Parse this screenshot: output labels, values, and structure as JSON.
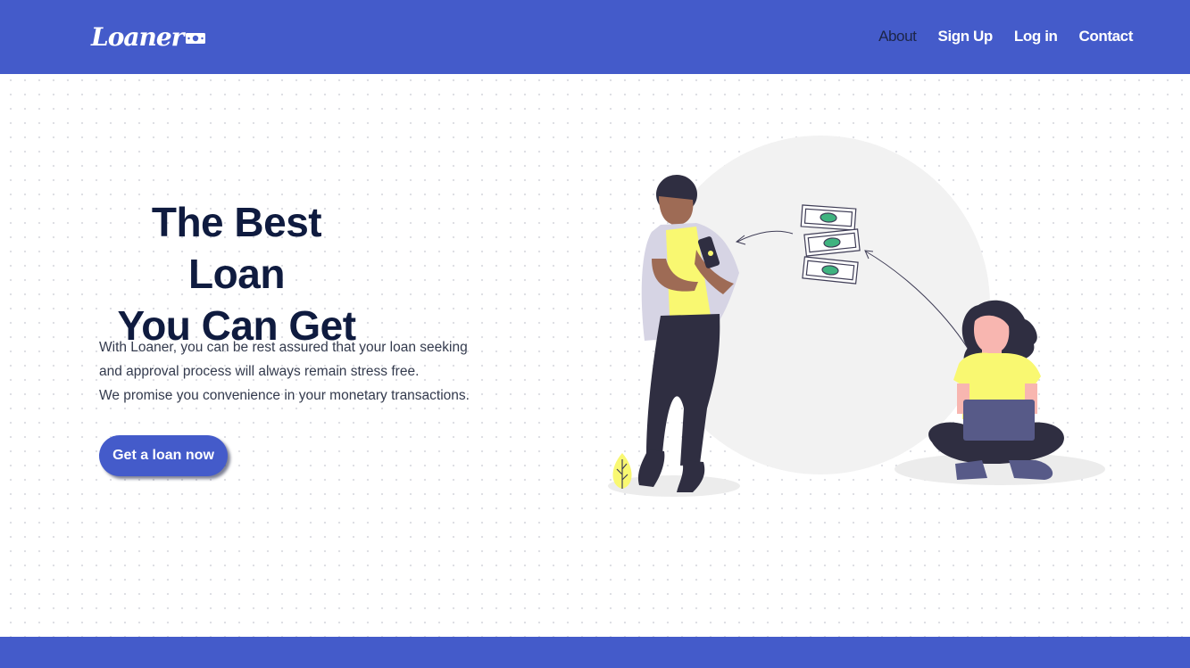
{
  "brand": {
    "name": "Loaner",
    "bill_icon": "money-bill-icon"
  },
  "nav": {
    "items": [
      {
        "label": "About",
        "active": true
      },
      {
        "label": "Sign Up",
        "active": false
      },
      {
        "label": "Log in",
        "active": false
      },
      {
        "label": "Contact",
        "active": false
      }
    ]
  },
  "hero": {
    "title_lines": [
      "The Best Loan",
      "You Can Get"
    ],
    "description_lines": [
      "With Loaner, you can be rest assured that your loan seeking",
      "and approval process will always remain stress free.",
      "We promise you convenience in your monetary transactions."
    ],
    "cta_label": "Get a loan now"
  },
  "colors": {
    "primary": "#445bca",
    "heading": "#0f1b3f",
    "accent_yellow": "#f9f871",
    "money_green": "#3fb37f"
  },
  "illustration": {
    "icon": "money-transfer-illustration"
  }
}
